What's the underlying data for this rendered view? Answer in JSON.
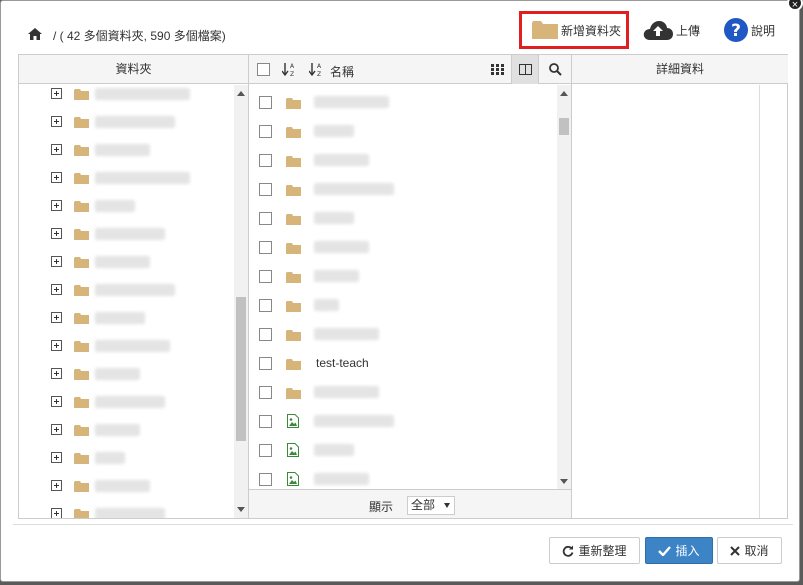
{
  "breadcrumb": {
    "text": "/ ( 42 多個資料夾, 590 多個檔案)"
  },
  "toolbar": {
    "new_folder": "新增資料夾",
    "upload": "上傳",
    "help": "說明"
  },
  "folder_pane": {
    "title": "資料夾",
    "row_count": 16
  },
  "file_pane": {
    "name_header": "名稱",
    "rows": [
      {
        "type": "folder",
        "name": ""
      },
      {
        "type": "folder",
        "name": ""
      },
      {
        "type": "folder",
        "name": ""
      },
      {
        "type": "folder",
        "name": ""
      },
      {
        "type": "folder",
        "name": ""
      },
      {
        "type": "folder",
        "name": ""
      },
      {
        "type": "folder",
        "name": ""
      },
      {
        "type": "folder",
        "name": ""
      },
      {
        "type": "folder",
        "name": ""
      },
      {
        "type": "folder",
        "name": "test-teach"
      },
      {
        "type": "folder",
        "name": ""
      },
      {
        "type": "image",
        "name": ""
      },
      {
        "type": "image",
        "name": ""
      },
      {
        "type": "image",
        "name": ""
      }
    ],
    "show_label": "顯示",
    "show_value": "全部"
  },
  "detail_pane": {
    "title": "詳細資料"
  },
  "buttons": {
    "refresh": "重新整理",
    "insert": "插入",
    "cancel": "取消"
  },
  "colors": {
    "folder": "#d7b47a",
    "primary": "#3c84c6",
    "highlight": "#e02020",
    "image_icon": "#3a8a3a"
  },
  "icons": {
    "home": "home-icon",
    "folder": "folder-icon",
    "upload": "cloud-upload-icon",
    "help": "question-circle-icon",
    "grid": "grid-icon",
    "columns": "columns-icon",
    "search": "search-icon",
    "refresh": "refresh-icon",
    "check": "check-icon",
    "close": "close-icon",
    "sort_az": "sort-alpha-icon",
    "sort_num": "sort-numeric-icon"
  }
}
